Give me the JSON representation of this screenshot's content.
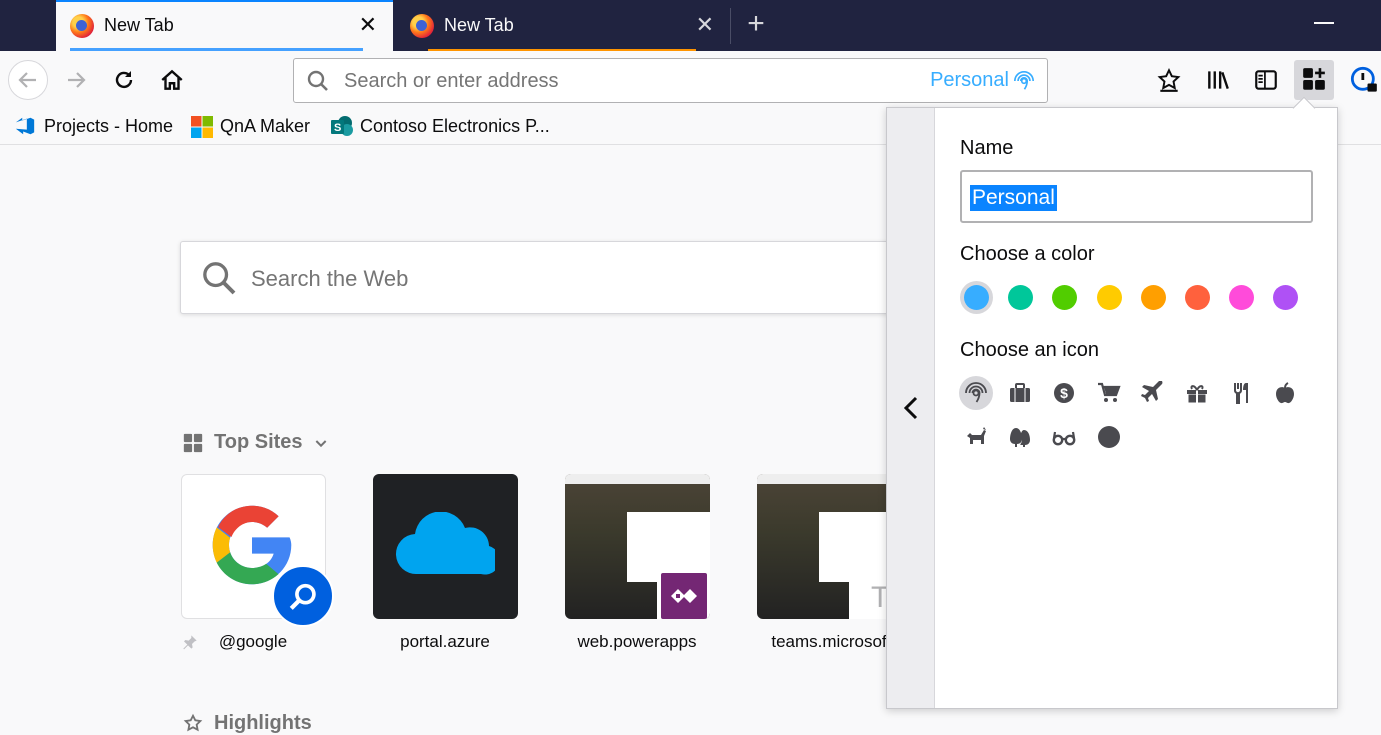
{
  "tabs": [
    {
      "title": "New Tab",
      "active": true
    },
    {
      "title": "New Tab",
      "active": false
    }
  ],
  "navbar": {
    "url_placeholder": "Search or enter address",
    "container_name": "Personal",
    "container_color": "#37adff"
  },
  "bookmarks": [
    {
      "label": "Projects - Home",
      "icon": "azure-devops-icon"
    },
    {
      "label": "QnA Maker",
      "icon": "microsoft-logo-icon"
    },
    {
      "label": "Contoso Electronics P...",
      "icon": "sharepoint-icon"
    }
  ],
  "newtab": {
    "search_placeholder": "Search the Web",
    "topsites_title": "Top Sites",
    "highlights_title": "Highlights",
    "sites": [
      {
        "label": "@google",
        "pinned": true
      },
      {
        "label": "portal.azure"
      },
      {
        "label": "web.powerapps"
      },
      {
        "label": "teams.microsof"
      }
    ]
  },
  "container_panel": {
    "name_label": "Name",
    "name_value": "Personal",
    "color_label": "Choose a color",
    "colors": [
      "#37adff",
      "#00c79a",
      "#51cd00",
      "#ffcb00",
      "#ff9f00",
      "#ff613d",
      "#ff4bda",
      "#af51f5"
    ],
    "selected_color": "#37adff",
    "icon_label": "Choose an icon",
    "icons": [
      "fingerprint",
      "briefcase",
      "dollar",
      "cart",
      "vacation",
      "gift",
      "food",
      "fruit",
      "pet",
      "tree",
      "chill",
      "circle"
    ],
    "selected_icon": "fingerprint"
  }
}
